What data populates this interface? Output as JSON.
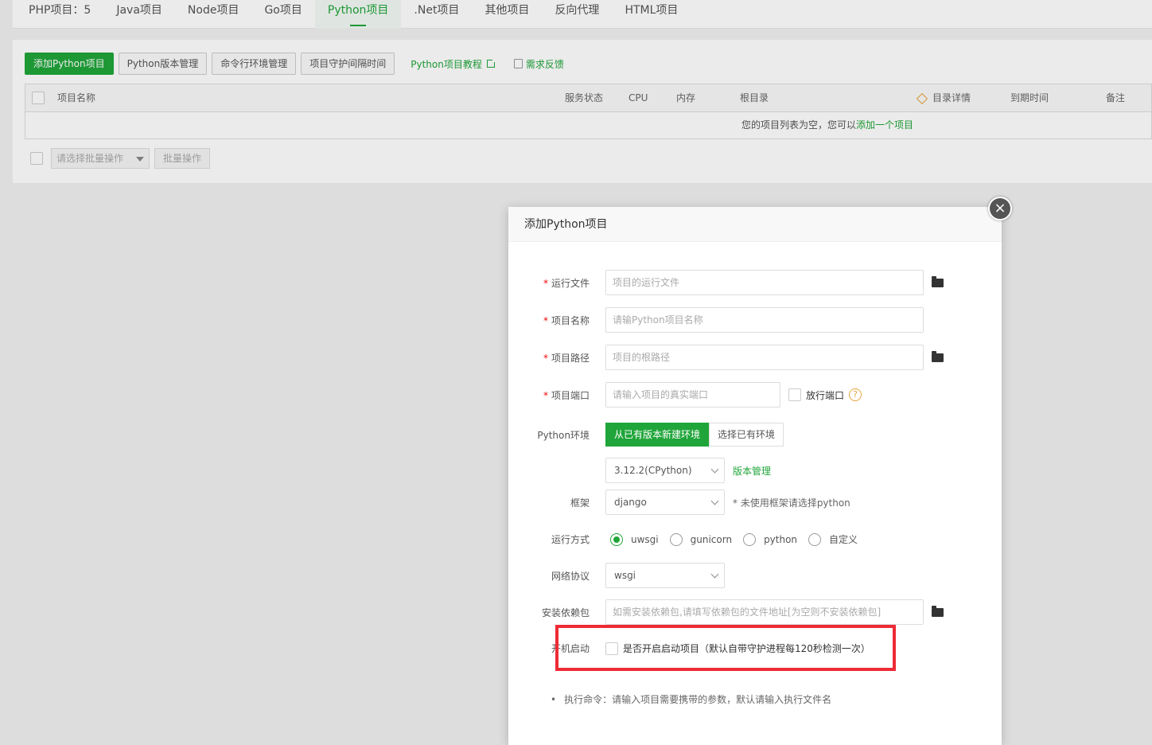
{
  "tabs": [
    "PHP项目：5",
    "Java项目",
    "Node项目",
    "Go项目",
    "Python项目",
    ".Net项目",
    "其他项目",
    "反向代理",
    "HTML项目"
  ],
  "active_tab": "Python项目",
  "toolbar": {
    "add": "添加Python项目",
    "version": "Python版本管理",
    "cmd_env": "命令行环境管理",
    "guard": "项目守护间隔时间",
    "tutorial": "Python项目教程",
    "feedback": "需求反馈"
  },
  "table": {
    "headers": {
      "name": "项目名称",
      "status": "服务状态",
      "cpu": "CPU",
      "mem": "内存",
      "root": "根目录",
      "detail": "目录详情",
      "expire": "到期时间",
      "remark": "备注"
    },
    "empty_msg": "您的项目列表为空，您可以",
    "empty_link": "添加一个项目"
  },
  "batch": {
    "placeholder": "请选择批量操作",
    "button": "批量操作"
  },
  "modal": {
    "title": "添加Python项目",
    "close": "×",
    "run_file_label": "运行文件",
    "run_file_placeholder": "项目的运行文件",
    "name_label": "项目名称",
    "name_placeholder": "请输Python项目名称",
    "path_label": "项目路径",
    "path_placeholder": "项目的根路径",
    "port_label": "项目端口",
    "port_placeholder": "请输入项目的真实端口",
    "open_port": "放行端口",
    "help": "?",
    "env_label": "Python环境",
    "env_new": "从已有版本新建环境",
    "env_select": "选择已有环境",
    "version_value": "3.12.2(CPython)",
    "version_manage": "版本管理",
    "framework_label": "框架",
    "framework_value": "django",
    "framework_hint": "* 未使用框架请选择python",
    "run_mode_label": "运行方式",
    "run_modes": [
      "uwsgi",
      "gunicorn",
      "python",
      "自定义"
    ],
    "run_mode_selected": "uwsgi",
    "protocol_label": "网络协议",
    "protocol_value": "wsgi",
    "deps_label": "安装依赖包",
    "deps_placeholder": "如需安装依赖包,请填写依赖包的文件地址[为空则不安装依赖包]",
    "autostart_label": "开机启动",
    "autostart_text": "是否开启启动项目（默认自带守护进程每120秒检测一次）",
    "note": "执行命令：请输入项目需要携带的参数，默认请输入执行文件名"
  },
  "colors": {
    "accent": "#20a53a",
    "highlight": "#ee2b36"
  }
}
